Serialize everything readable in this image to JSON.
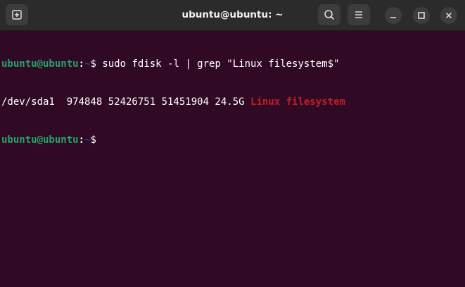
{
  "window": {
    "title": "ubuntu@ubuntu: ~"
  },
  "toolbar": {
    "new_tab_icon": "new-tab-icon",
    "search_icon": "search-icon",
    "menu_icon": "hamburger-menu-icon",
    "minimize_icon": "minimize-icon",
    "maximize_icon": "maximize-icon",
    "close_icon": "close-icon"
  },
  "terminal": {
    "prompt_user": "ubuntu@ubuntu",
    "prompt_sep": ":",
    "prompt_path": "~",
    "prompt_sign": "$ ",
    "command": "sudo fdisk -l | grep \"Linux filesystem$\"",
    "output_prefix": "/dev/sda1  974848 52426751 51451904 24.5G ",
    "output_match": "Linux filesystem",
    "prompt2_user": "ubuntu@ubuntu",
    "prompt2_sep": ":",
    "prompt2_path": "~",
    "prompt2_sign": "$"
  },
  "colors": {
    "background": "#300a24",
    "titlebar": "#2b2b2b",
    "prompt_user": "#26a269",
    "prompt_path": "#12488b",
    "match": "#c01c28"
  }
}
